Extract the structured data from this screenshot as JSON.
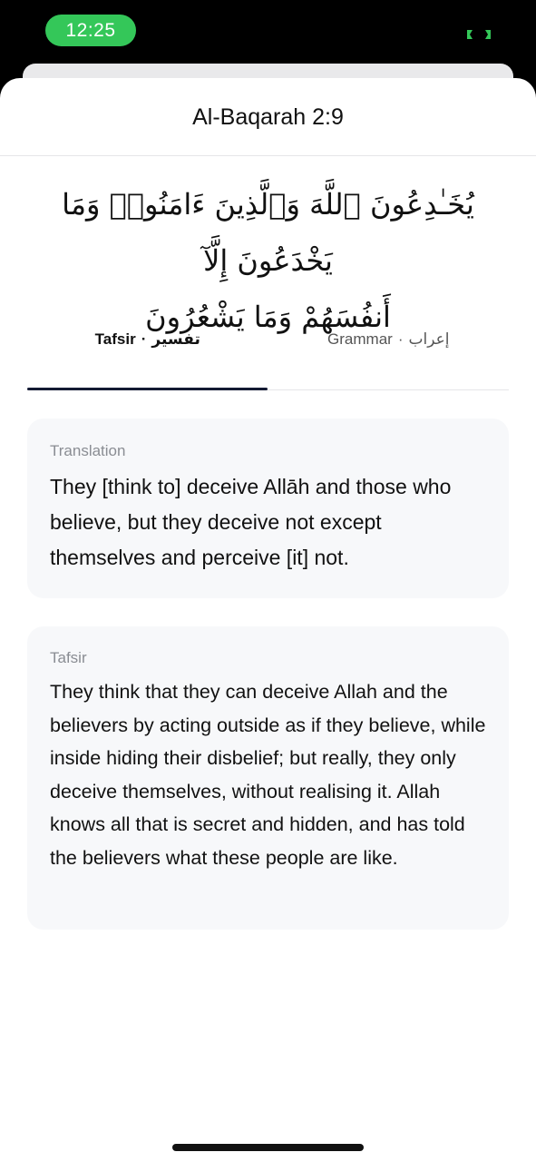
{
  "status_bar": {
    "time": "12:25",
    "accent_color": "#34c759"
  },
  "header": {
    "title": "Al-Baqarah 2:9"
  },
  "verse": {
    "arabic_line1": "يُخَـٰدِعُونَ ٱللَّهَ وَٱلَّذِينَ ءَامَنُوا۟ وَمَا يَخْدَعُونَ إِلَّآ",
    "arabic_line2": "أَنفُسَهُمْ وَمَا يَشْعُرُونَ"
  },
  "tabs": [
    {
      "label_en": "Tafsir",
      "separator": "·",
      "label_ar": "تفسير",
      "active": true
    },
    {
      "label_en": "Grammar",
      "separator": "·",
      "label_ar": "إعراب",
      "active": false
    }
  ],
  "translation": {
    "label": "Translation",
    "text": "They [think to] deceive Allāh and those who believe, but they deceive not except themselves and perceive [it] not."
  },
  "tafsir": {
    "label": "Tafsir",
    "text": "They think that they can deceive Allah and the believers by acting outside as if they believe, while inside hiding their disbelief; but really, they only deceive themselves, without realising it. Allah knows all that is secret and hidden, and has told the believers what these people are like."
  }
}
